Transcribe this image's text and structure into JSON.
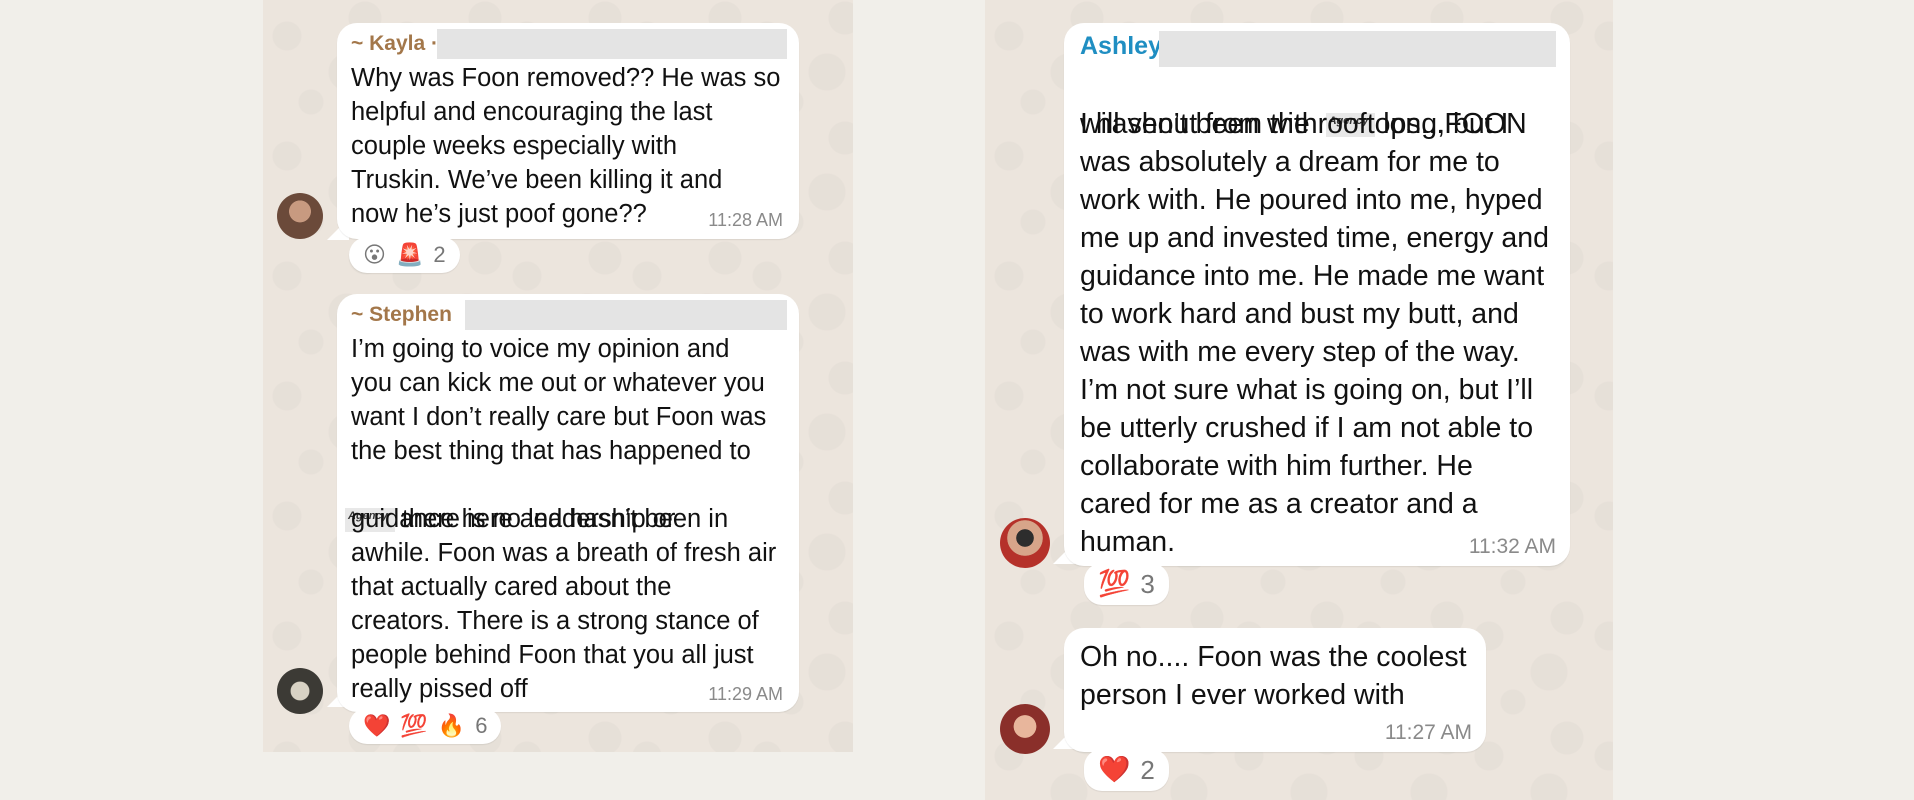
{
  "left": {
    "messages": [
      {
        "sender": "~ Kayla ·",
        "text": "Why was Foon removed?? He was so\nhelpful and encouraging the last\ncouple weeks especially with\nTruskin. We’ve been killing it and\nnow he’s just poof gone??",
        "time": "11:28 AM",
        "reactions": {
          "emojis": [
            "😮",
            "🚨"
          ],
          "count": "2"
        }
      },
      {
        "sender": "~ Stephen",
        "text_before": "I’m going to voice my opinion and\nyou can kick me out or whatever you\nwant I don’t really care but Foon was\nthe best thing that has happened to",
        "agency_label": "Agency",
        "text_inline": " there is no leadership or",
        "text_after": "guidance here and hasn’t been in\nawhile. Foon was a breath of fresh air\nthat actually cared about the\ncreators. There is a strong stance of\npeople behind Foon that you all just\nreally pissed off",
        "time": "11:29 AM",
        "reactions": {
          "emojis": [
            "❤️",
            "💯",
            "🔥"
          ],
          "count": "6"
        }
      }
    ]
  },
  "right": {
    "messages": [
      {
        "sender": "Ashley (",
        "line1_before": "I haven’t been with ",
        "agency_label": "Agency",
        "line1_after": " long, but I",
        "text": "will shout from the rooftops...FOON\nwas absolutely a dream for me to\nwork with. He poured into me, hyped\nme up and invested time, energy and\nguidance into me. He made me want\nto work hard and bust my butt, and\nwas with me every step of the way.\nI’m not sure what is going on, but I’ll\nbe utterly crushed if I am not able to\ncollaborate with him further. He\ncared for me as a creator and a\nhuman.",
        "time": "11:32 AM",
        "reactions": {
          "emojis": [
            "💯"
          ],
          "count": "3"
        }
      },
      {
        "text": "Oh no.... Foon was the coolest\nperson I ever worked with",
        "time": "11:27 AM",
        "reactions": {
          "emojis": [
            "❤️"
          ],
          "count": "2"
        }
      }
    ]
  }
}
